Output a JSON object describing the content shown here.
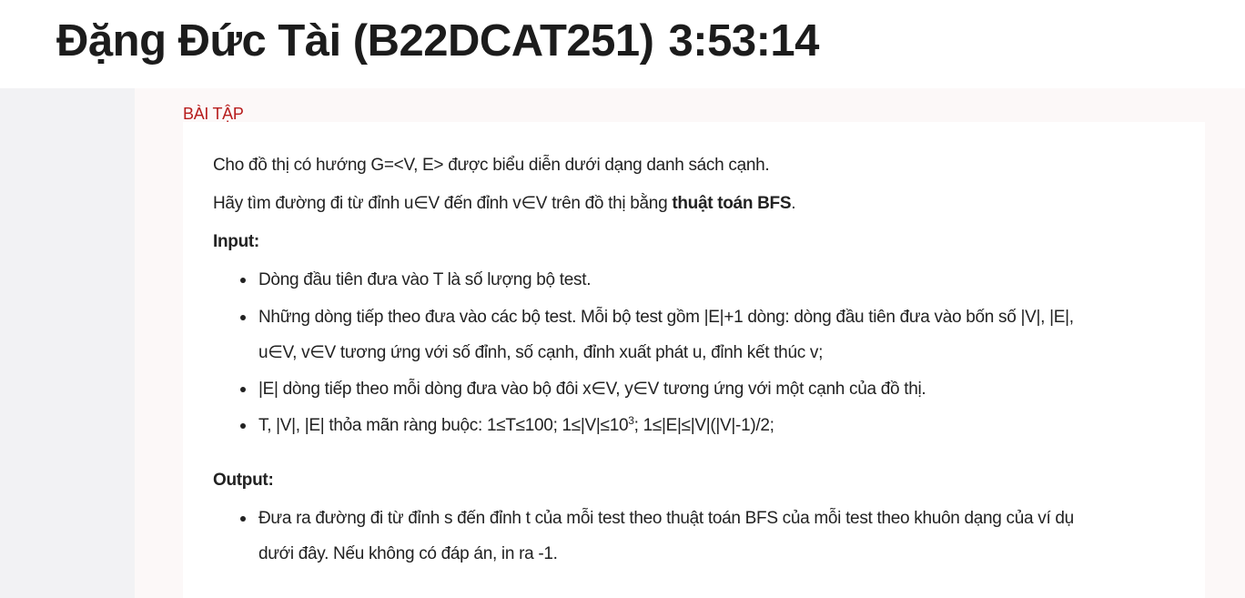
{
  "header": {
    "title": "Đặng Đức Tài (B22DCAT251)",
    "timer": "3:53:14"
  },
  "section_label": "BÀI TẬP",
  "problem": {
    "intro_line1": "Cho đồ thị có hướng G=<V, E> được biểu diễn dưới dạng danh sách cạnh.",
    "intro_line2_prefix": "Hãy tìm đường đi từ đỉnh u∈V đến đỉnh v∈V trên đồ thị bằng ",
    "intro_line2_bold": "thuật toán BFS",
    "intro_line2_suffix": ".",
    "input_heading": "Input:",
    "input_items": [
      "Dòng đầu tiên đưa vào T là số lượng bộ test.",
      "Những dòng tiếp theo đưa vào các bộ test. Mỗi bộ test gồm |E|+1 dòng: dòng đầu tiên đưa vào bốn số |V|, |E|,",
      "u∈V, v∈V tương ứng với số đỉnh, số cạnh,  đỉnh xuất phát u, đỉnh kết thúc v;",
      "|E| dòng tiếp theo mỗi dòng đưa vào bộ đôi x∈V, y∈V tương ứng với một cạnh của đồ thị."
    ],
    "constraint_prefix": "T, |V|, |E| thỏa mãn ràng buộc: 1≤T≤100; 1≤|V|≤10",
    "constraint_sup": "3",
    "constraint_suffix": "; 1≤|E|≤|V|(|V|-1)/2;",
    "output_heading": "Output:",
    "output_items": [
      "Đưa ra đường đi từ đỉnh s đến đỉnh t của mỗi test theo thuật toán BFS của mỗi test theo khuôn dạng của ví dụ",
      "dưới đây. Nếu không có đáp án, in ra -1."
    ]
  }
}
